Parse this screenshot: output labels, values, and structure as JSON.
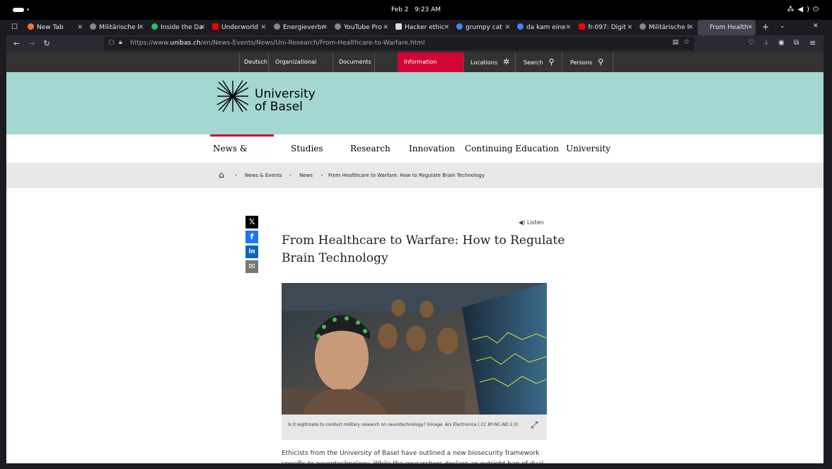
{
  "os": {
    "date": "Feb 2",
    "time": "9:23 AM"
  },
  "browser": {
    "tabs": [
      {
        "label": "New Tab",
        "color": "#ff7139"
      },
      {
        "label": "Militärische I",
        "color": "#888888"
      },
      {
        "label": "Inside the Da",
        "color": "#22c55e"
      },
      {
        "label": "Underworld",
        "color": "#ff0000"
      },
      {
        "label": "Energieverbr",
        "color": "#888888"
      },
      {
        "label": "YouTube Pro",
        "color": "#888888"
      },
      {
        "label": "Hacker ethic",
        "color": "#dddddd"
      },
      {
        "label": "grumpy cat",
        "color": "#4285f4"
      },
      {
        "label": "da kam eine",
        "color": "#4285f4"
      },
      {
        "label": "fr-097: Digit",
        "color": "#ff0000"
      },
      {
        "label": "Militärische I",
        "color": "#888888"
      },
      {
        "label": "From Health",
        "color": "#42414d"
      }
    ],
    "url_prefix": "https://www.",
    "url_domain": "unibas.ch",
    "url_path": "/en/News-Events/News/Uni-Research/From-Healthcare-to-Warfare.html"
  },
  "utility_nav": {
    "deutsch": "Deutsch",
    "org_units": "Organizational units",
    "documents": "Documents",
    "info_for": "Information for...",
    "locations": "Locations",
    "search": "Search",
    "persons": "Persons"
  },
  "logo": {
    "line1": "University",
    "line2": "of Basel"
  },
  "main_nav": [
    "News & Events",
    "Studies",
    "Research",
    "Innovation",
    "Continuing Education",
    "University"
  ],
  "breadcrumbs": [
    "News & Events",
    "News",
    "From Healthcare to Warfare: How to Regulate Brain Technology"
  ],
  "article": {
    "listen": "Listen",
    "title": "From Healthcare to Warfare: How to Regulate Brain Technology",
    "caption": "Is it legitimate to conduct military research on neurotechnology? (Image: Ars Electronica | CC BY-NC-ND 2.0)",
    "body": "Ethicists from the University of Basel have outlined a new biosecurity framework specific to neurotechnology. While the researchers declare an outright ban of dual-use"
  },
  "colors": {
    "accent": "#d20537",
    "mint": "#a5d7d2"
  }
}
